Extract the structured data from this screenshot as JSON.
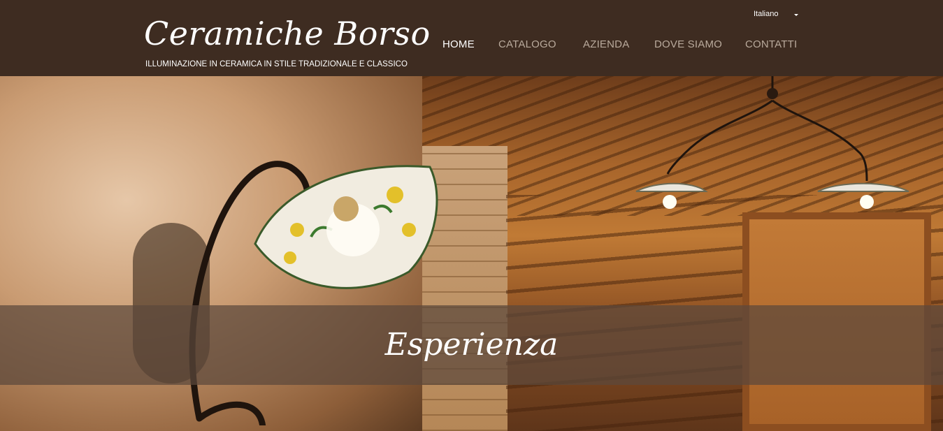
{
  "header": {
    "logo_script": "Ceramiche Borso",
    "logo_tagline": "ILLUMINAZIONE IN CERAMICA IN STILE TRADIZIONALE E CLASSICO",
    "language": "Italiano"
  },
  "nav": {
    "items": [
      {
        "label": "HOME",
        "active": true
      },
      {
        "label": "CATALOGO",
        "active": false
      },
      {
        "label": "AZIENDA",
        "active": false
      },
      {
        "label": "DOVE SIAMO",
        "active": false
      },
      {
        "label": "CONTATTI",
        "active": false
      }
    ]
  },
  "hero": {
    "caption": "Esperienza"
  },
  "colors": {
    "header_bg": "#3e2c21",
    "nav_active": "#ffffff",
    "nav_inactive": "#b9aa9c",
    "band_overlay": "#5c483c"
  },
  "icons": {
    "language_dropdown": "caret-down-icon"
  }
}
